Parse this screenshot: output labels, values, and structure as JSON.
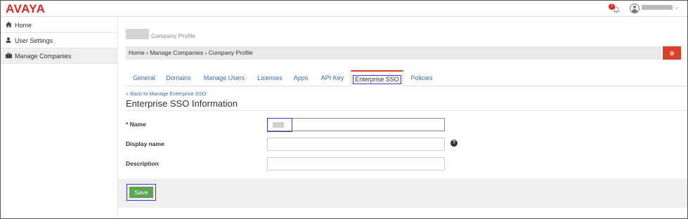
{
  "header": {
    "logo_text": "AVAYA",
    "notification_count": "3",
    "user_caret": "⌵"
  },
  "sidebar": {
    "items": [
      {
        "label": "Home",
        "icon": "home-icon"
      },
      {
        "label": "User Settings",
        "icon": "user-icon"
      },
      {
        "label": "Manage Companies",
        "icon": "briefcase-icon",
        "active": true
      }
    ]
  },
  "main": {
    "company_title": "Company Profile",
    "breadcrumb": "Home › Manage Companies › Company Profile",
    "tabs": [
      {
        "label": "General"
      },
      {
        "label": "Domains"
      },
      {
        "label": "Manage Users"
      },
      {
        "label": "Licenses"
      },
      {
        "label": "Apps"
      },
      {
        "label": "API Key"
      },
      {
        "label": "Enterprise SSO",
        "active": true
      },
      {
        "label": "Policies"
      }
    ],
    "back_link": "« Back to Manage Enterprise SSO",
    "section_title": "Enterprise SSO Information",
    "form": {
      "name_label": "* Name",
      "display_name_label": "Display name",
      "description_label": "Description",
      "help_glyph": "?"
    },
    "save_label": "Save"
  },
  "colors": {
    "brand": "#da291c",
    "link": "#3a6c9e",
    "save": "#5aa454",
    "gear": "#d9412a",
    "highlight": "#3a3ad0"
  }
}
